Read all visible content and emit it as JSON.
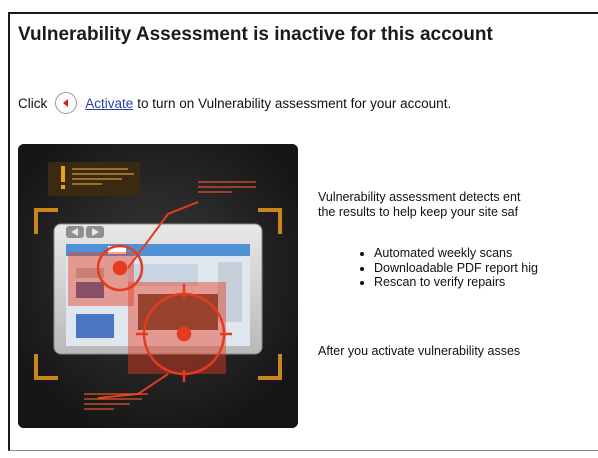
{
  "heading": "Vulnerability Assessment is inactive for this account",
  "instruction": {
    "prefix": "Click",
    "link": "Activate",
    "suffix": "to turn on Vulnerability assessment for your account."
  },
  "description": {
    "line1": "Vulnerability assessment detects ent",
    "line2": "the results to help keep your site saf"
  },
  "features": [
    "Automated weekly scans",
    "Downloadable PDF report hig",
    "Rescan to verify repairs"
  ],
  "after_text": "After you activate vulnerability asses",
  "illustration": {
    "icons": [
      "warning-icon",
      "target-icon",
      "back-arrow-icon",
      "forward-arrow-icon"
    ]
  },
  "colors": {
    "link": "#2a3fa8",
    "accent": "#e53b1f",
    "illustration_bg": "#1a1a1a",
    "bracket": "#c9851f"
  }
}
